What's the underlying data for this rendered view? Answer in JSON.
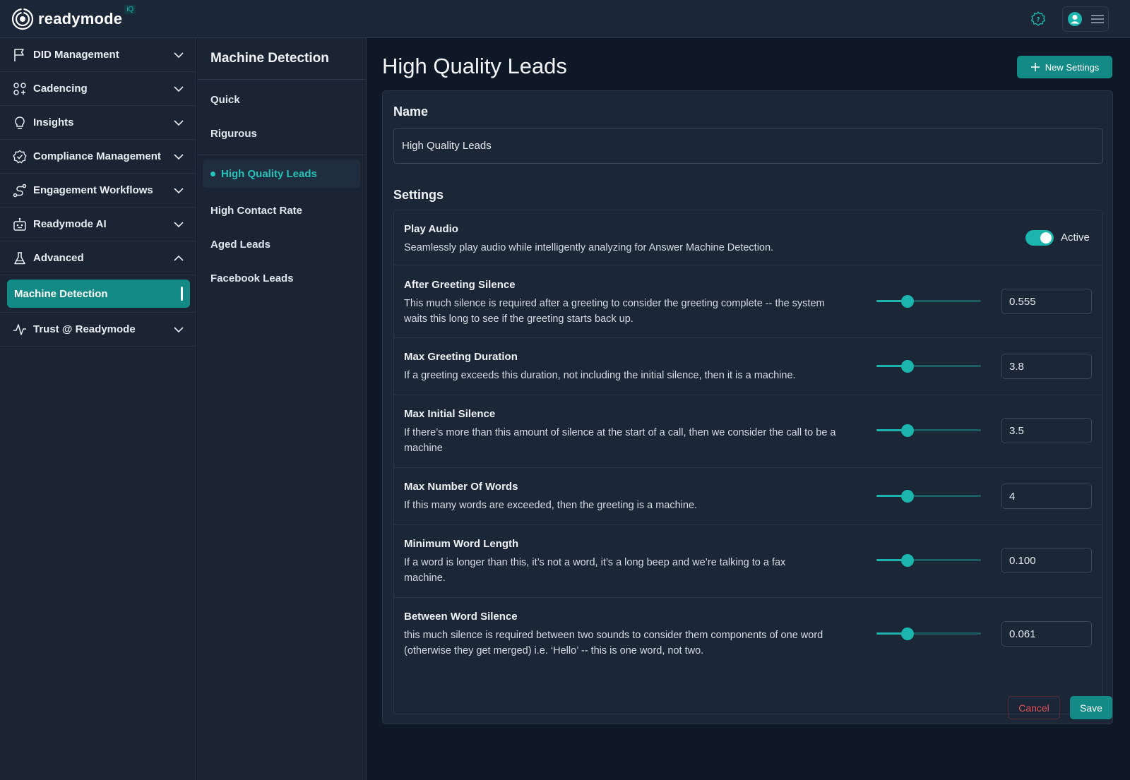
{
  "app": {
    "logo_text": "readymode",
    "logo_badge": "iQ",
    "accent_color": "#1bb5ad"
  },
  "sidebar": {
    "items": [
      {
        "label": "DID Management",
        "icon": "flag-icon",
        "state": "collapsed"
      },
      {
        "label": "Cadencing",
        "icon": "grid-nodes-icon",
        "state": "collapsed"
      },
      {
        "label": "Insights",
        "icon": "lightbulb-icon",
        "state": "collapsed"
      },
      {
        "label": "Compliance Management",
        "icon": "badge-check-icon",
        "state": "collapsed"
      },
      {
        "label": "Engagement Workflows",
        "icon": "route-icon",
        "state": "collapsed"
      },
      {
        "label": "Readymode AI",
        "icon": "robot-icon",
        "state": "collapsed"
      },
      {
        "label": "Advanced",
        "icon": "flask-icon",
        "state": "expanded"
      },
      {
        "label": "Trust @ Readymode",
        "icon": "pulse-icon",
        "state": "collapsed"
      }
    ],
    "active_subitem": "Machine Detection"
  },
  "secondary_nav": {
    "title": "Machine Detection",
    "items": [
      "Quick",
      "Rigurous",
      "High Quality Leads",
      "High Contact Rate",
      "Aged Leads",
      "Facebook Leads"
    ],
    "active": "High Quality Leads"
  },
  "main": {
    "title": "High Quality Leads",
    "new_button": "New Settings",
    "name_heading": "Name",
    "name_value": "High Quality Leads",
    "settings_heading": "Settings",
    "play_audio": {
      "title": "Play Audio",
      "description": "Seamlessly play audio while intelligently analyzing for Answer Machine Detection.",
      "toggle_label": "Active",
      "enabled": true
    },
    "settings": [
      {
        "title": "After Greeting Silence",
        "description": "This much silence is required after a greeting to consider the greeting complete -- the system waits this long to see if the greeting starts back up.",
        "value": "0.555",
        "slider_fraction": 0.3
      },
      {
        "title": "Max Greeting Duration",
        "description": "If a greeting exceeds this duration, not including the initial silence, then it is a machine.",
        "value": "3.8",
        "slider_fraction": 0.3
      },
      {
        "title": "Max Initial Silence",
        "description": "If there’s more than this amount of silence at the start of a call, then we consider the call to be a machine",
        "value": "3.5",
        "slider_fraction": 0.3
      },
      {
        "title": "Max Number Of Words",
        "description": "If this many words are exceeded, then the greeting is a machine.",
        "value": "4",
        "slider_fraction": 0.3
      },
      {
        "title": "Minimum Word Length",
        "description": "If a word is longer than this, it’s not a word, it’s a long beep and we’re talking to a fax machine.",
        "value": "0.100",
        "slider_fraction": 0.3
      },
      {
        "title": "Between Word Silence",
        "description": "this much silence is required between two sounds to consider them components of one word (otherwise they get merged) i.e. ‘Hello’ -- this is one word, not two.",
        "value": "0.061",
        "slider_fraction": 0.3
      }
    ],
    "cancel_button": "Cancel",
    "save_button": "Save"
  }
}
